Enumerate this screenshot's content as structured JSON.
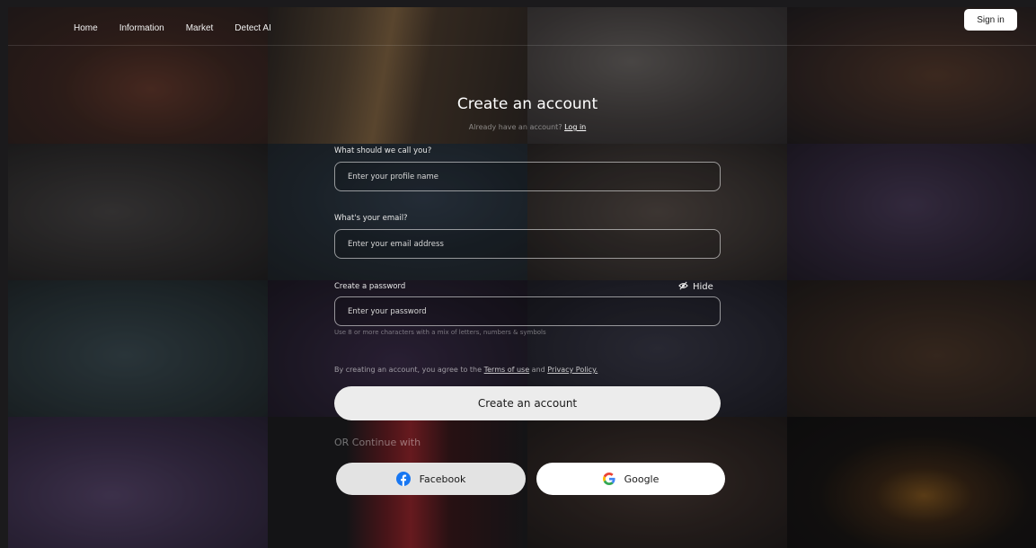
{
  "nav": {
    "links": [
      "Home",
      "Information",
      "Market",
      "Detect AI"
    ],
    "signin_label": "Sign in"
  },
  "form": {
    "title": "Create an account",
    "subtitle_text": "Already have an account?",
    "login_link": "Log in",
    "name_label": "What should we call you?",
    "name_placeholder": "Enter your profile name",
    "email_label": "What's your email?",
    "email_placeholder": "Enter your email address",
    "password_label": "Create a password",
    "hide_label": "Hide",
    "password_placeholder": "Enter your password",
    "password_hint": "Use 8 or more characters with a mix of letters, numbers & symbols",
    "terms_prefix": "By creating an account, you agree to the",
    "terms_link": "Terms of use",
    "terms_and": "and",
    "privacy_link": "Privacy Policy.",
    "submit_label": "Create an account",
    "or_text": "OR Continue with",
    "facebook_label": "Facebook",
    "google_label": "Google"
  },
  "colors": {
    "facebook_blue": "#1877F2",
    "google_blue": "#4285F4",
    "google_red": "#EA4335",
    "google_yellow": "#FBBC05",
    "google_green": "#34A853"
  },
  "icons": [
    "eye-off-icon",
    "facebook-icon",
    "google-icon"
  ]
}
